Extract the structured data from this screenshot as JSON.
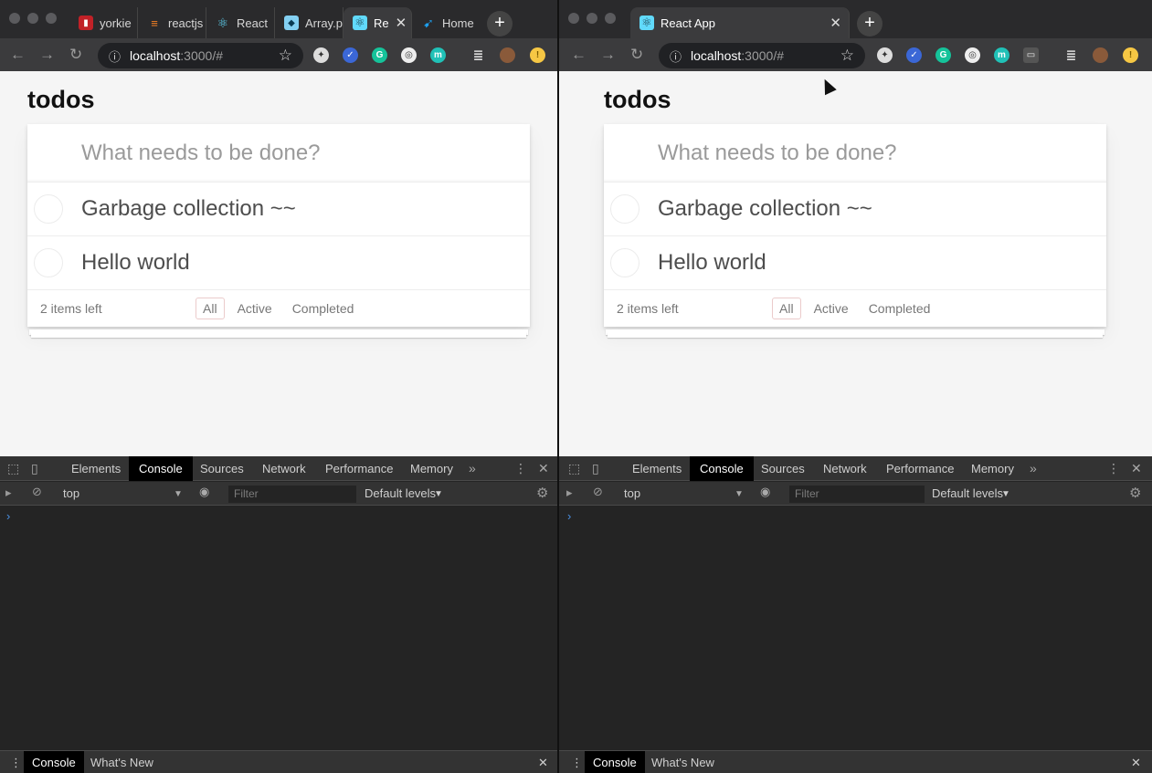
{
  "colors": {
    "accent_blue": "#4a90e2",
    "filter_border": "#e4c4c4"
  },
  "left": {
    "tabs": [
      {
        "label": "yorkie",
        "icon": "npm-icon",
        "color": "#c12127"
      },
      {
        "label": "reactjs",
        "icon": "stackoverflow-icon",
        "color": "#f48024"
      },
      {
        "label": "React",
        "icon": "react-icon",
        "color": "#61dafb"
      },
      {
        "label": "Array.p",
        "icon": "mdn-icon",
        "color": "#83d0f2"
      },
      {
        "label": "Re",
        "icon": "react-icon",
        "color": "#61dafb",
        "active": true
      },
      {
        "label": "Home",
        "icon": "twitter-icon",
        "color": "#1da1f2"
      }
    ],
    "url_host": "localhost",
    "url_rest": ":3000/#"
  },
  "right": {
    "tabs": [
      {
        "label": "React App",
        "icon": "react-icon",
        "color": "#61dafb",
        "active": true
      }
    ],
    "url_host": "localhost",
    "url_rest": ":3000/#"
  },
  "app": {
    "title": "todos",
    "new_todo_placeholder": "What needs to be done?",
    "items": [
      "Garbage collection ~~",
      "Hello world"
    ],
    "items_left": "2 items left",
    "filters": [
      "All",
      "Active",
      "Completed"
    ],
    "selected_filter": "All"
  },
  "devtools": {
    "tabs": [
      "Elements",
      "Console",
      "Sources",
      "Network",
      "Performance",
      "Memory"
    ],
    "active_tab": "Console",
    "context": "top",
    "filter_placeholder": "Filter",
    "levels": "Default levels",
    "prompt": "›",
    "drawer_tabs": [
      "Console",
      "What's New"
    ]
  }
}
